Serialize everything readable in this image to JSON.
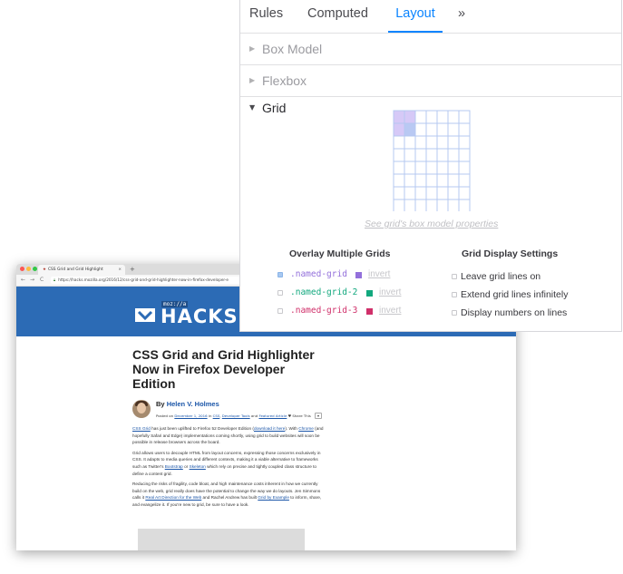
{
  "browser": {
    "tab_title": "CSS Grid and Grid Highlight",
    "tab_close": "×",
    "new_tab": "+",
    "nav": {
      "back": "←",
      "forward": "→",
      "reload": "C"
    },
    "url": "https://hacks.mozilla.org/2016/12/css-grid-and-grid-highlighter-now-in-firefox-developer-e",
    "site": {
      "badge": "moz://a",
      "name": "HACKS"
    },
    "article": {
      "title": "CSS Grid and Grid Highlighter Now in Firefox Developer Edition",
      "by": "By",
      "author": "Helen V. Holmes",
      "meta_posted": "Posted on",
      "meta_date": "December 1, 2016",
      "meta_in": "in",
      "meta_cat1": "CSS",
      "meta_cat2": "Developer Tools",
      "meta_and": "and",
      "meta_cat3": "Featured Article",
      "share": "Share This",
      "p1_link": "CSS Grid",
      "p1_text": " has just been uplifted to Firefox 52 Developer Edition (",
      "p1_link2": "download it here",
      "p1_text2": "). With ",
      "p1_link3": "Chrome",
      "p1_text3": " (and hopefully Safari and Edge) implementations coming shortly, using grid to build websites will soon be possible in release browsers across the board.",
      "p2_text": "Grid allows users to decouple HTML from layout concerns, expressing those concerns exclusively in CSS. It adapts to media queries and different contexts, making it a viable alternative to frameworks such as Twitter's ",
      "p2_link": "Bootstrap",
      "p2_text2": " or ",
      "p2_link2": "Skeleton",
      "p2_text3": " which rely on precise and tightly coupled class structure to define a content grid.",
      "p3_text": "Reducing the risks of fragility, code bloat, and high maintenance costs inherent in how we currently build on the web, grid really does have the potential to change the way we do layouts. Jen Simmons calls it ",
      "p3_link": "Real Art Direction for the Web",
      "p3_text2": " and Rachel Andrew has built ",
      "p3_link2": "Grid by Example",
      "p3_text3": " to inform, share, and evangelize it. If you're new to grid, be sure to have a look."
    }
  },
  "devtools": {
    "tabs": {
      "rules": "Rules",
      "computed": "Computed",
      "layout": "Layout",
      "more": "»"
    },
    "sections": {
      "box_model": "Box Model",
      "flexbox": "Flexbox",
      "grid": "Grid"
    },
    "box_model_link": "See grid's box model properties",
    "overlay_title": "Overlay Multiple Grids",
    "display_title": "Grid Display Settings",
    "grids": [
      {
        "name": ".named-grid",
        "color": "#9370db",
        "invert": "invert",
        "checked": true
      },
      {
        "name": ".named-grid-2",
        "color": "#12a87e",
        "invert": "invert",
        "checked": false
      },
      {
        "name": ".named-grid-3",
        "color": "#d0306a",
        "invert": "invert",
        "checked": false
      }
    ],
    "settings": [
      {
        "label": "Leave grid lines on",
        "checked": false
      },
      {
        "label": "Extend grid lines infinitely",
        "checked": false
      },
      {
        "label": "Display numbers on lines",
        "checked": false
      }
    ],
    "grid_outline": {
      "columns": 7,
      "rows": 8,
      "highlighted_cells": [
        [
          0,
          0
        ],
        [
          0,
          1
        ],
        [
          1,
          0
        ],
        [
          1,
          1
        ]
      ]
    }
  },
  "colors": {
    "accent": "#0a84ff",
    "hero": "#2c6bb5",
    "link": "#1a55a8"
  }
}
